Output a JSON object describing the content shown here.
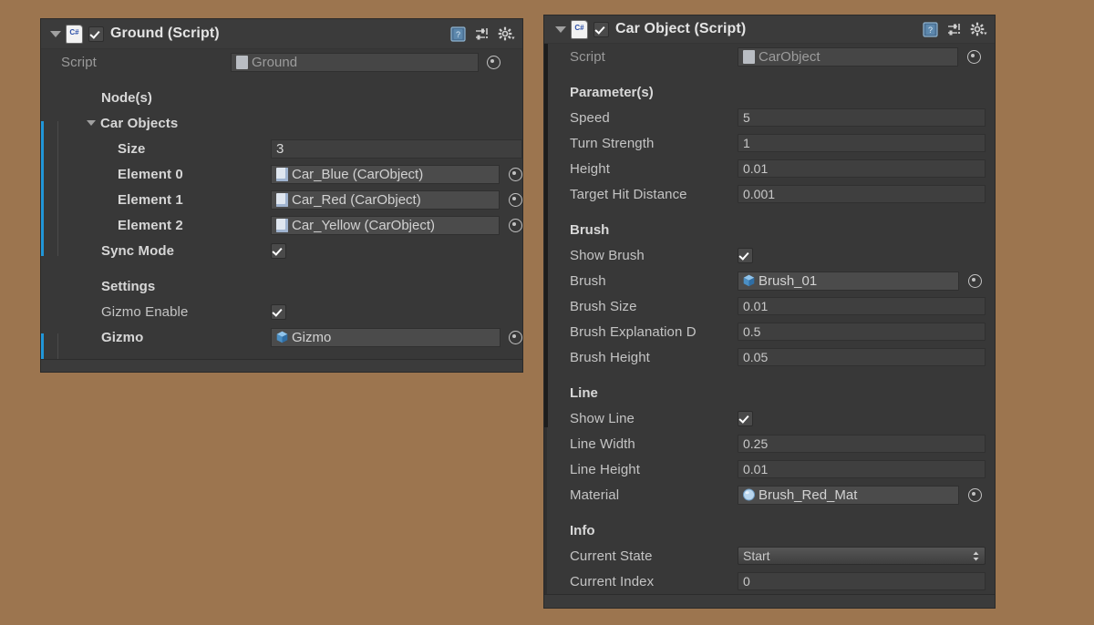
{
  "background_color": "#9c754f",
  "theme": {
    "panel_bg": "#3b3b3b",
    "field_bg": "#424242",
    "object_field_bg": "#4b4b4b",
    "text": "#c4c4c4",
    "override_marker": "#2196d8"
  },
  "panels": [
    {
      "id": "ground",
      "header": {
        "title": "Ground (Script)",
        "enabled_checkbox": true,
        "foldout_expanded": true,
        "script_badge": "csharp-script-icon",
        "icons": [
          "help-icon",
          "preset-icon",
          "settings-gear-icon"
        ]
      },
      "script_row": {
        "label": "Script",
        "value": "Ground",
        "icon": "script-asset-icon"
      },
      "sections": [
        {
          "title": "Node(s)",
          "rows": [
            {
              "type": "foldout",
              "label": "Car Objects",
              "expanded": true
            },
            {
              "type": "number",
              "label": "Size",
              "value": "3",
              "indent": 2
            },
            {
              "type": "object",
              "label": "Element 0",
              "value": "Car_Blue (CarObject)",
              "icon": "prefab-icon",
              "indent": 2
            },
            {
              "type": "object",
              "label": "Element 1",
              "value": "Car_Red (CarObject)",
              "icon": "prefab-icon",
              "indent": 2
            },
            {
              "type": "object",
              "label": "Element 2",
              "value": "Car_Yellow (CarObject)",
              "icon": "prefab-icon",
              "indent": 2
            },
            {
              "type": "toggle",
              "label": "Sync Mode",
              "value": true,
              "indent": 1
            }
          ]
        },
        {
          "title": "Settings",
          "rows": [
            {
              "type": "toggle",
              "label": "Gizmo Enable",
              "value": true,
              "indent": 1
            },
            {
              "type": "object",
              "label": "Gizmo",
              "value": "Gizmo",
              "icon": "cube-prefab-icon",
              "indent": 1
            }
          ]
        }
      ]
    },
    {
      "id": "car-object",
      "header": {
        "title": "Car Object (Script)",
        "enabled_checkbox": true,
        "foldout_expanded": true,
        "script_badge": "csharp-script-icon",
        "icons": [
          "help-icon",
          "preset-icon",
          "settings-gear-icon"
        ]
      },
      "script_row": {
        "label": "Script",
        "value": "CarObject",
        "icon": "script-asset-icon"
      },
      "sections": [
        {
          "title": "Parameter(s)",
          "rows": [
            {
              "type": "number",
              "label": "Speed",
              "value": "5"
            },
            {
              "type": "number",
              "label": "Turn Strength",
              "value": "1"
            },
            {
              "type": "number",
              "label": "Height",
              "value": "0.01"
            },
            {
              "type": "number",
              "label": "Target Hit Distance",
              "value": "0.001"
            }
          ]
        },
        {
          "title": "Brush",
          "rows": [
            {
              "type": "toggle",
              "label": "Show Brush",
              "value": true
            },
            {
              "type": "object",
              "label": "Brush",
              "value": "Brush_01",
              "icon": "cube-prefab-icon"
            },
            {
              "type": "number",
              "label": "Brush Size",
              "value": "0.01"
            },
            {
              "type": "number",
              "label": "Brush Explanation D",
              "value": "0.5"
            },
            {
              "type": "number",
              "label": "Brush Height",
              "value": "0.05"
            }
          ]
        },
        {
          "title": "Line",
          "rows": [
            {
              "type": "toggle",
              "label": "Show Line",
              "value": true
            },
            {
              "type": "number",
              "label": "Line Width",
              "value": "0.25"
            },
            {
              "type": "number",
              "label": "Line Height",
              "value": "0.01"
            },
            {
              "type": "object",
              "label": "Material",
              "value": "Brush_Red_Mat",
              "icon": "material-sphere-icon"
            }
          ]
        },
        {
          "title": "Info",
          "rows": [
            {
              "type": "popup",
              "label": "Current State",
              "value": "Start"
            },
            {
              "type": "number",
              "label": "Current Index",
              "value": "0"
            }
          ]
        }
      ]
    }
  ]
}
